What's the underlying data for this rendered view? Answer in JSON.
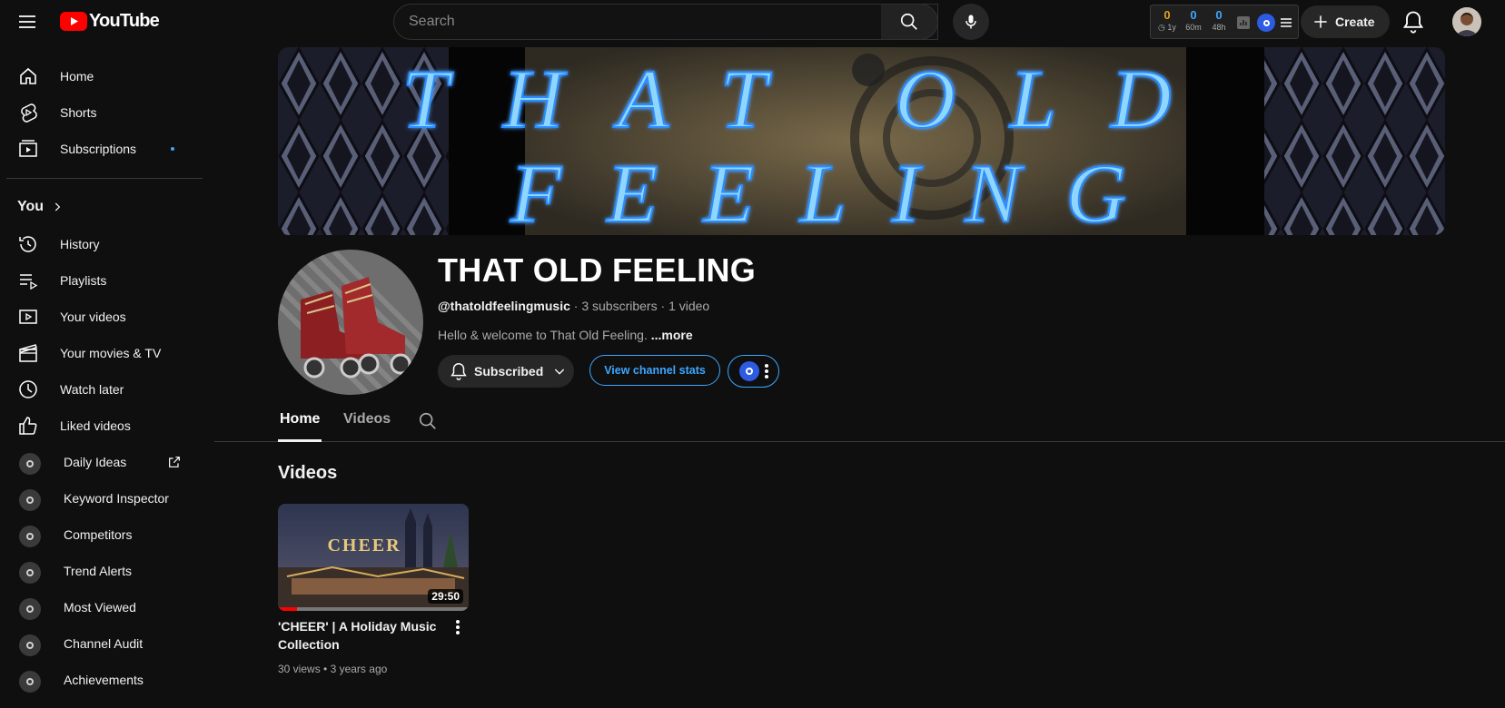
{
  "header": {
    "logo_text": "YouTube",
    "search_placeholder": "Search",
    "stats": [
      {
        "value": "0",
        "label": "1y",
        "color": "#e0a020"
      },
      {
        "value": "0",
        "label": "60m",
        "color": "#3ea6ff"
      },
      {
        "value": "0",
        "label": "48h",
        "color": "#3ea6ff"
      }
    ],
    "create_label": "Create"
  },
  "sidebar": {
    "main": [
      {
        "label": "Home",
        "icon": "home-icon"
      },
      {
        "label": "Shorts",
        "icon": "shorts-icon"
      },
      {
        "label": "Subscriptions",
        "icon": "subscriptions-icon"
      }
    ],
    "you_label": "You",
    "you_items": [
      {
        "label": "History",
        "icon": "history-icon"
      },
      {
        "label": "Playlists",
        "icon": "playlists-icon"
      },
      {
        "label": "Your videos",
        "icon": "your-videos-icon"
      },
      {
        "label": "Your movies & TV",
        "icon": "movies-icon"
      },
      {
        "label": "Watch later",
        "icon": "clock-icon"
      },
      {
        "label": "Liked videos",
        "icon": "thumbs-up-icon"
      }
    ],
    "vidiq_items": [
      {
        "label": "Daily Ideas"
      },
      {
        "label": "Keyword Inspector"
      },
      {
        "label": "Competitors"
      },
      {
        "label": "Trend Alerts"
      },
      {
        "label": "Most Viewed"
      },
      {
        "label": "Channel Audit"
      },
      {
        "label": "Achievements"
      }
    ]
  },
  "channel": {
    "banner_text_line1": "THAT OLD",
    "banner_text_line2": "FEELING",
    "title": "THAT OLD FEELING",
    "handle": "@thatoldfeelingmusic",
    "subscribers": "3 subscribers",
    "videos_count": "1 video",
    "description": "Hello & welcome to That Old Feeling.",
    "more_label": "...more",
    "subscribed_label": "Subscribed",
    "stats_button_label": "View channel stats"
  },
  "tabs": [
    {
      "label": "Home",
      "active": true
    },
    {
      "label": "Videos",
      "active": false
    }
  ],
  "section": {
    "title": "Videos"
  },
  "video": {
    "thumb_text": "CHEER",
    "duration": "29:50",
    "title": "'CHEER' | A Holiday Music Collection",
    "views": "30 views",
    "age": "3 years ago",
    "watched_fraction": 0.1
  }
}
